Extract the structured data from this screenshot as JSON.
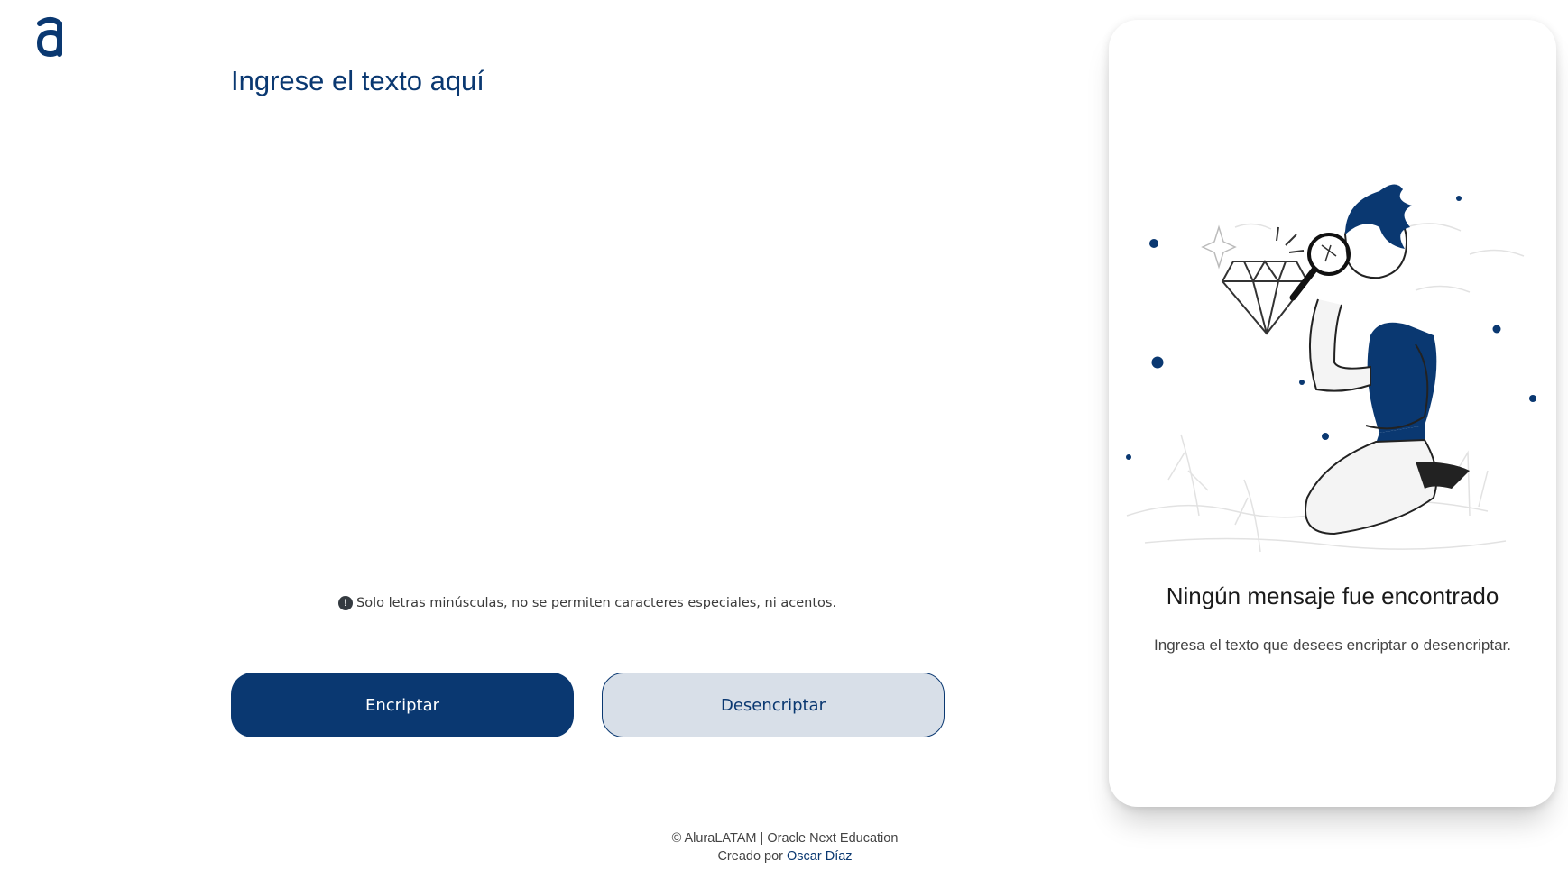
{
  "brand": {
    "logo_icon": "alura-a-logo-icon",
    "color": "#0a3871"
  },
  "input": {
    "placeholder": "Ingrese el texto aquí",
    "value": ""
  },
  "info": {
    "icon": "exclamation-circle-icon",
    "text": "Solo letras minúsculas, no se permiten caracteres especiales, ni acentos."
  },
  "buttons": {
    "encrypt": "Encriptar",
    "decrypt": "Desencriptar"
  },
  "footer": {
    "line1": "© AluraLATAM | Oracle Next Education",
    "created_by": "Creado por",
    "author": "Oscar Díaz"
  },
  "output": {
    "illustration_icon": "person-magnifying-glass-diamond-illustration",
    "title": "Ningún mensaje fue encontrado",
    "subtitle": "Ingresa el texto que desees encriptar o desencriptar."
  },
  "colors": {
    "primary": "#0a3871",
    "secondary_bg": "#d8dfe8"
  }
}
